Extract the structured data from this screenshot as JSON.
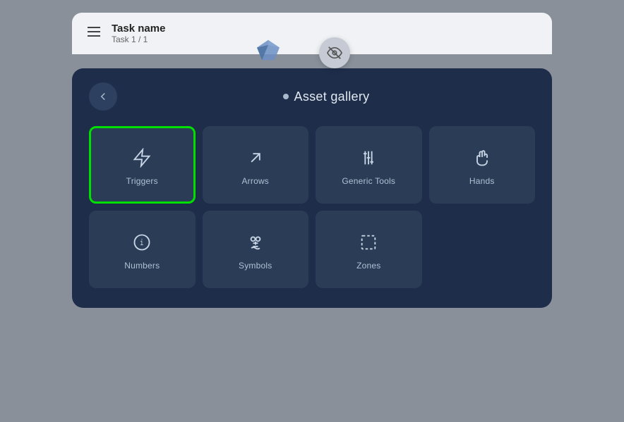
{
  "taskBar": {
    "iconLabel": "☰",
    "taskName": "Task name",
    "taskSub": "Task 1 / 1"
  },
  "gallery": {
    "title": "Asset gallery",
    "backLabel": "back",
    "items": [
      {
        "id": "triggers",
        "label": "Triggers",
        "icon": "lightning",
        "selected": true
      },
      {
        "id": "arrows",
        "label": "Arrows",
        "icon": "arrow-diagonal",
        "selected": false
      },
      {
        "id": "generic-tools",
        "label": "Generic Tools",
        "icon": "tools",
        "selected": false
      },
      {
        "id": "hands",
        "label": "Hands",
        "icon": "hand",
        "selected": false
      },
      {
        "id": "numbers",
        "label": "Numbers",
        "icon": "circle-1",
        "selected": false
      },
      {
        "id": "symbols",
        "label": "Symbols",
        "icon": "symbols",
        "selected": false
      },
      {
        "id": "zones",
        "label": "Zones",
        "icon": "dashed-rect",
        "selected": false
      }
    ]
  }
}
